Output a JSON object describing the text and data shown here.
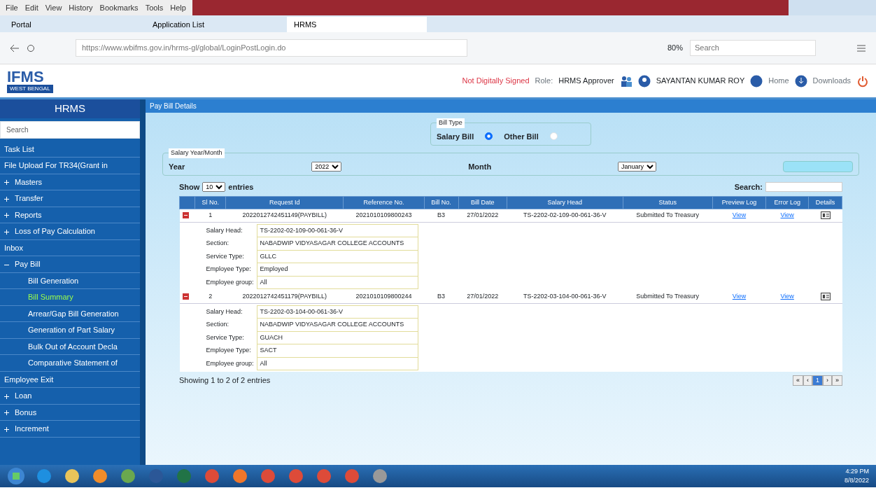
{
  "browser": {
    "menu": [
      "File",
      "Edit",
      "View",
      "History",
      "Bookmarks",
      "Tools",
      "Help"
    ],
    "tabs": [
      {
        "label": "Portal",
        "selected": false
      },
      {
        "label": "Application List",
        "selected": false
      },
      {
        "label": "HRMS",
        "selected": true
      }
    ],
    "url": "https://www.wbifms.gov.in/hrms-gl/global/LoginPostLogin.do",
    "zoom": "80%",
    "search": {
      "placeholder": "Search"
    }
  },
  "header": {
    "logo": "IFMS",
    "logo_sub": "WEST BENGAL",
    "sign_status": "Not Digitally Signed",
    "role_label": "Role:",
    "role": "HRMS Approver",
    "user": "SAYANTAN KUMAR ROY",
    "home": "Home",
    "downloads": "Downloads"
  },
  "sidebar": {
    "title": "HRMS",
    "search": {
      "placeholder": "Search"
    },
    "items": [
      {
        "label": "Task List"
      },
      {
        "label": "File Upload For TR34(Grant in"
      },
      {
        "label": "Masters",
        "expanded": false
      },
      {
        "label": "Transfer",
        "expanded": false
      },
      {
        "label": "Reports",
        "expanded": false
      },
      {
        "label": "Loss of Pay Calculation",
        "expanded": false
      },
      {
        "label": "Inbox"
      },
      {
        "label": "Pay Bill",
        "expanded": true,
        "children": [
          {
            "label": "Bill Generation",
            "selected": false
          },
          {
            "label": "Bill Summary",
            "selected": true
          },
          {
            "label": "Arrear/Gap Bill Generation",
            "selected": false
          },
          {
            "label": "Generation of Part Salary",
            "selected": false
          },
          {
            "label": "Bulk Out of Account Decla",
            "selected": false
          },
          {
            "label": "Comparative Statement of",
            "selected": false
          }
        ]
      },
      {
        "label": "Employee Exit"
      },
      {
        "label": "Loan",
        "expanded": false
      },
      {
        "label": "Bonus",
        "expanded": false
      },
      {
        "label": "Increment",
        "expanded": false
      }
    ]
  },
  "content": {
    "breadcrumb": "Pay Bill Details",
    "bill_type": {
      "legend": "Bill Type",
      "options": [
        {
          "label": "Salary Bill",
          "selected": true
        },
        {
          "label": "Other Bill",
          "selected": false
        }
      ]
    },
    "period": {
      "legend": "Salary Year/Month",
      "year_label": "Year",
      "year": "2022",
      "month_label": "Month",
      "month": "January"
    },
    "table": {
      "show": "Show",
      "length": "10",
      "entries": "entries",
      "search_label": "Search:",
      "columns": [
        "Sl No.",
        "Request Id",
        "Reference No.",
        "Bill No.",
        "Bill Date",
        "Salary Head",
        "Status",
        "Preview Log",
        "Error Log",
        "Details"
      ],
      "rows": [
        {
          "cells": [
            "1",
            "2022012742451149(PAYBILL)",
            "2021010109800243",
            "B3",
            "27/01/2022",
            "TS-2202-02-109-00-061-36-V",
            "Submitted To Treasury",
            "View",
            "View"
          ],
          "expanded": true,
          "details": [
            [
              "Salary Head:",
              "TS-2202-02-109-00-061-36-V"
            ],
            [
              "Section:",
              "NABADWIP VIDYASAGAR COLLEGE ACCOUNTS"
            ],
            [
              "Service Type:",
              "GLLC"
            ],
            [
              "Employee Type:",
              "Employed"
            ],
            [
              "Employee group:",
              "All"
            ]
          ]
        },
        {
          "cells": [
            "2",
            "2022012742451179(PAYBILL)",
            "2021010109800244",
            "B3",
            "27/01/2022",
            "TS-2202-03-104-00-061-36-V",
            "Submitted To Treasury",
            "View",
            "View"
          ],
          "expanded": true,
          "details": [
            [
              "Salary Head:",
              "TS-2202-03-104-00-061-36-V"
            ],
            [
              "Section:",
              "NABADWIP VIDYASAGAR COLLEGE ACCOUNTS"
            ],
            [
              "Service Type:",
              "GUACH"
            ],
            [
              "Employee Type:",
              "SACT"
            ],
            [
              "Employee group:",
              "All"
            ]
          ]
        }
      ],
      "info": "Showing 1 to 2 of 2 entries",
      "pages": [
        {
          "label": "«",
          "selected": false
        },
        {
          "label": "‹",
          "selected": false
        },
        {
          "label": "1",
          "selected": true
        },
        {
          "label": "›",
          "selected": false
        },
        {
          "label": "»",
          "selected": false
        }
      ]
    }
  },
  "taskbar": {
    "time": "4:29 PM",
    "date": "8/8/2022"
  }
}
